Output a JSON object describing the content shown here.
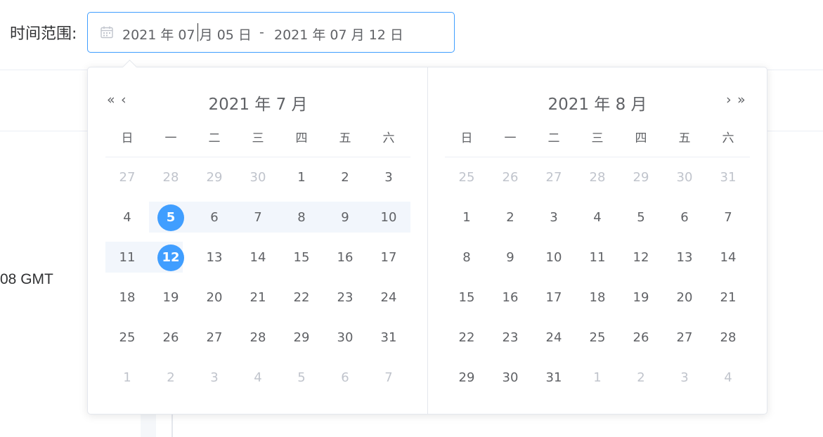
{
  "background": {
    "partial_text": "08 GMT"
  },
  "picker": {
    "label": "时间范围:",
    "start_value": "2021 年 07 月 05 日",
    "separator": "-",
    "end_value": "2021 年 07 月 12 日",
    "icon": "calendar-icon"
  },
  "weekdays": [
    "日",
    "一",
    "二",
    "三",
    "四",
    "五",
    "六"
  ],
  "left_month": {
    "title": "2021 年 7 月",
    "nav_prev_year": "«",
    "nav_prev_month": "‹",
    "weeks": [
      [
        "27",
        "28",
        "29",
        "30",
        "1",
        "2",
        "3"
      ],
      [
        "4",
        "5",
        "6",
        "7",
        "8",
        "9",
        "10"
      ],
      [
        "11",
        "12",
        "13",
        "14",
        "15",
        "16",
        "17"
      ],
      [
        "18",
        "19",
        "20",
        "21",
        "22",
        "23",
        "24"
      ],
      [
        "25",
        "26",
        "27",
        "28",
        "29",
        "30",
        "31"
      ],
      [
        "1",
        "2",
        "3",
        "4",
        "5",
        "6",
        "7"
      ]
    ]
  },
  "right_month": {
    "title": "2021 年 8 月",
    "nav_next_month": "›",
    "nav_next_year": "»",
    "weeks": [
      [
        "25",
        "26",
        "27",
        "28",
        "29",
        "30",
        "31"
      ],
      [
        "1",
        "2",
        "3",
        "4",
        "5",
        "6",
        "7"
      ],
      [
        "8",
        "9",
        "10",
        "11",
        "12",
        "13",
        "14"
      ],
      [
        "15",
        "16",
        "17",
        "18",
        "19",
        "20",
        "21"
      ],
      [
        "22",
        "23",
        "24",
        "25",
        "26",
        "27",
        "28"
      ],
      [
        "29",
        "30",
        "31",
        "1",
        "2",
        "3",
        "4"
      ]
    ]
  },
  "colors": {
    "accent": "#409eff",
    "range_bg": "#f2f6fc",
    "text": "#606266",
    "muted": "#c0c4cc"
  }
}
